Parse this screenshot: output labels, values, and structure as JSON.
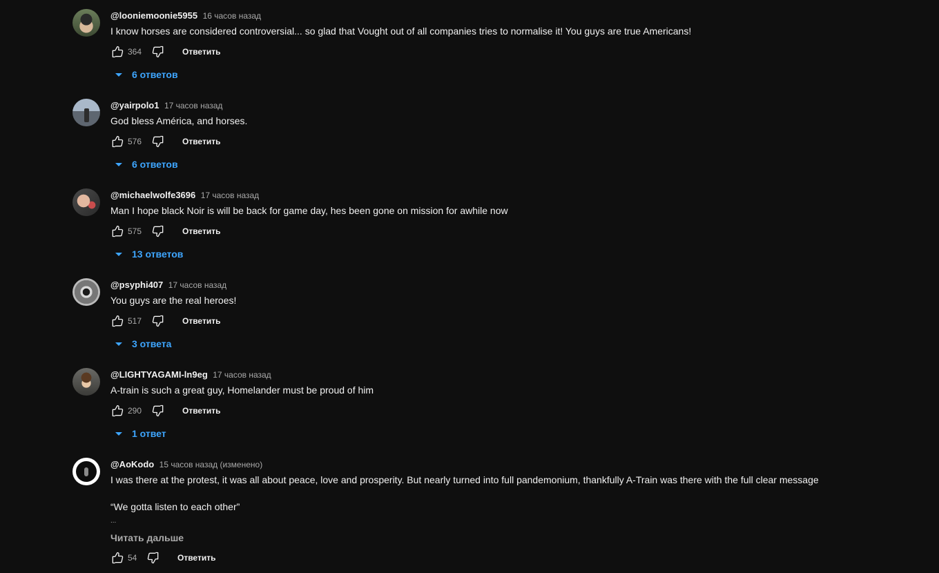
{
  "comments": [
    {
      "author": "@looniemoonie5955",
      "time": "16 часов назад",
      "text": "I know horses are considered controversial... so glad that Vought out of all companies tries to normalise it! You guys are true Americans!",
      "likes": "364",
      "reply_label": "Ответить",
      "replies_label": "6 ответов"
    },
    {
      "author": "@yairpolo1",
      "time": "17 часов назад",
      "text": "God bless América, and horses.",
      "likes": "576",
      "reply_label": "Ответить",
      "replies_label": "6 ответов"
    },
    {
      "author": "@michaelwolfe3696",
      "time": "17 часов назад",
      "text": "Man I hope black Noir is will be back for game day, hes been gone on mission for awhile now",
      "likes": "575",
      "reply_label": "Ответить",
      "replies_label": "13 ответов"
    },
    {
      "author": "@psyphi407",
      "time": "17 часов назад",
      "text": "You guys are the real heroes!",
      "likes": "517",
      "reply_label": "Ответить",
      "replies_label": "3 ответа"
    },
    {
      "author": "@LIGHTYAGAMI-ln9eg",
      "time": "17 часов назад",
      "text": "A-train is such a great guy, Homelander must be proud of him",
      "likes": "290",
      "reply_label": "Ответить",
      "replies_label": "1 ответ"
    },
    {
      "author": "@AoKodo",
      "time": "15 часов назад (изменено)",
      "text": "I was there at the protest, it was all about peace, love and prosperity. But nearly turned into full pandemonium, thankfully A-Train was there with the full clear message",
      "text_2": "“We gotta listen to each other”",
      "ellipsis": "...",
      "read_more": "Читать дальше",
      "likes": "54",
      "reply_label": "Ответить"
    }
  ],
  "icons": {
    "like": "thumbs-up-icon",
    "dislike": "thumbs-down-icon",
    "expand": "caret-down-icon"
  },
  "colors": {
    "background": "#0f0f0f",
    "text": "#f1f1f1",
    "secondary": "#aaaaaa",
    "link": "#3ea6ff"
  }
}
